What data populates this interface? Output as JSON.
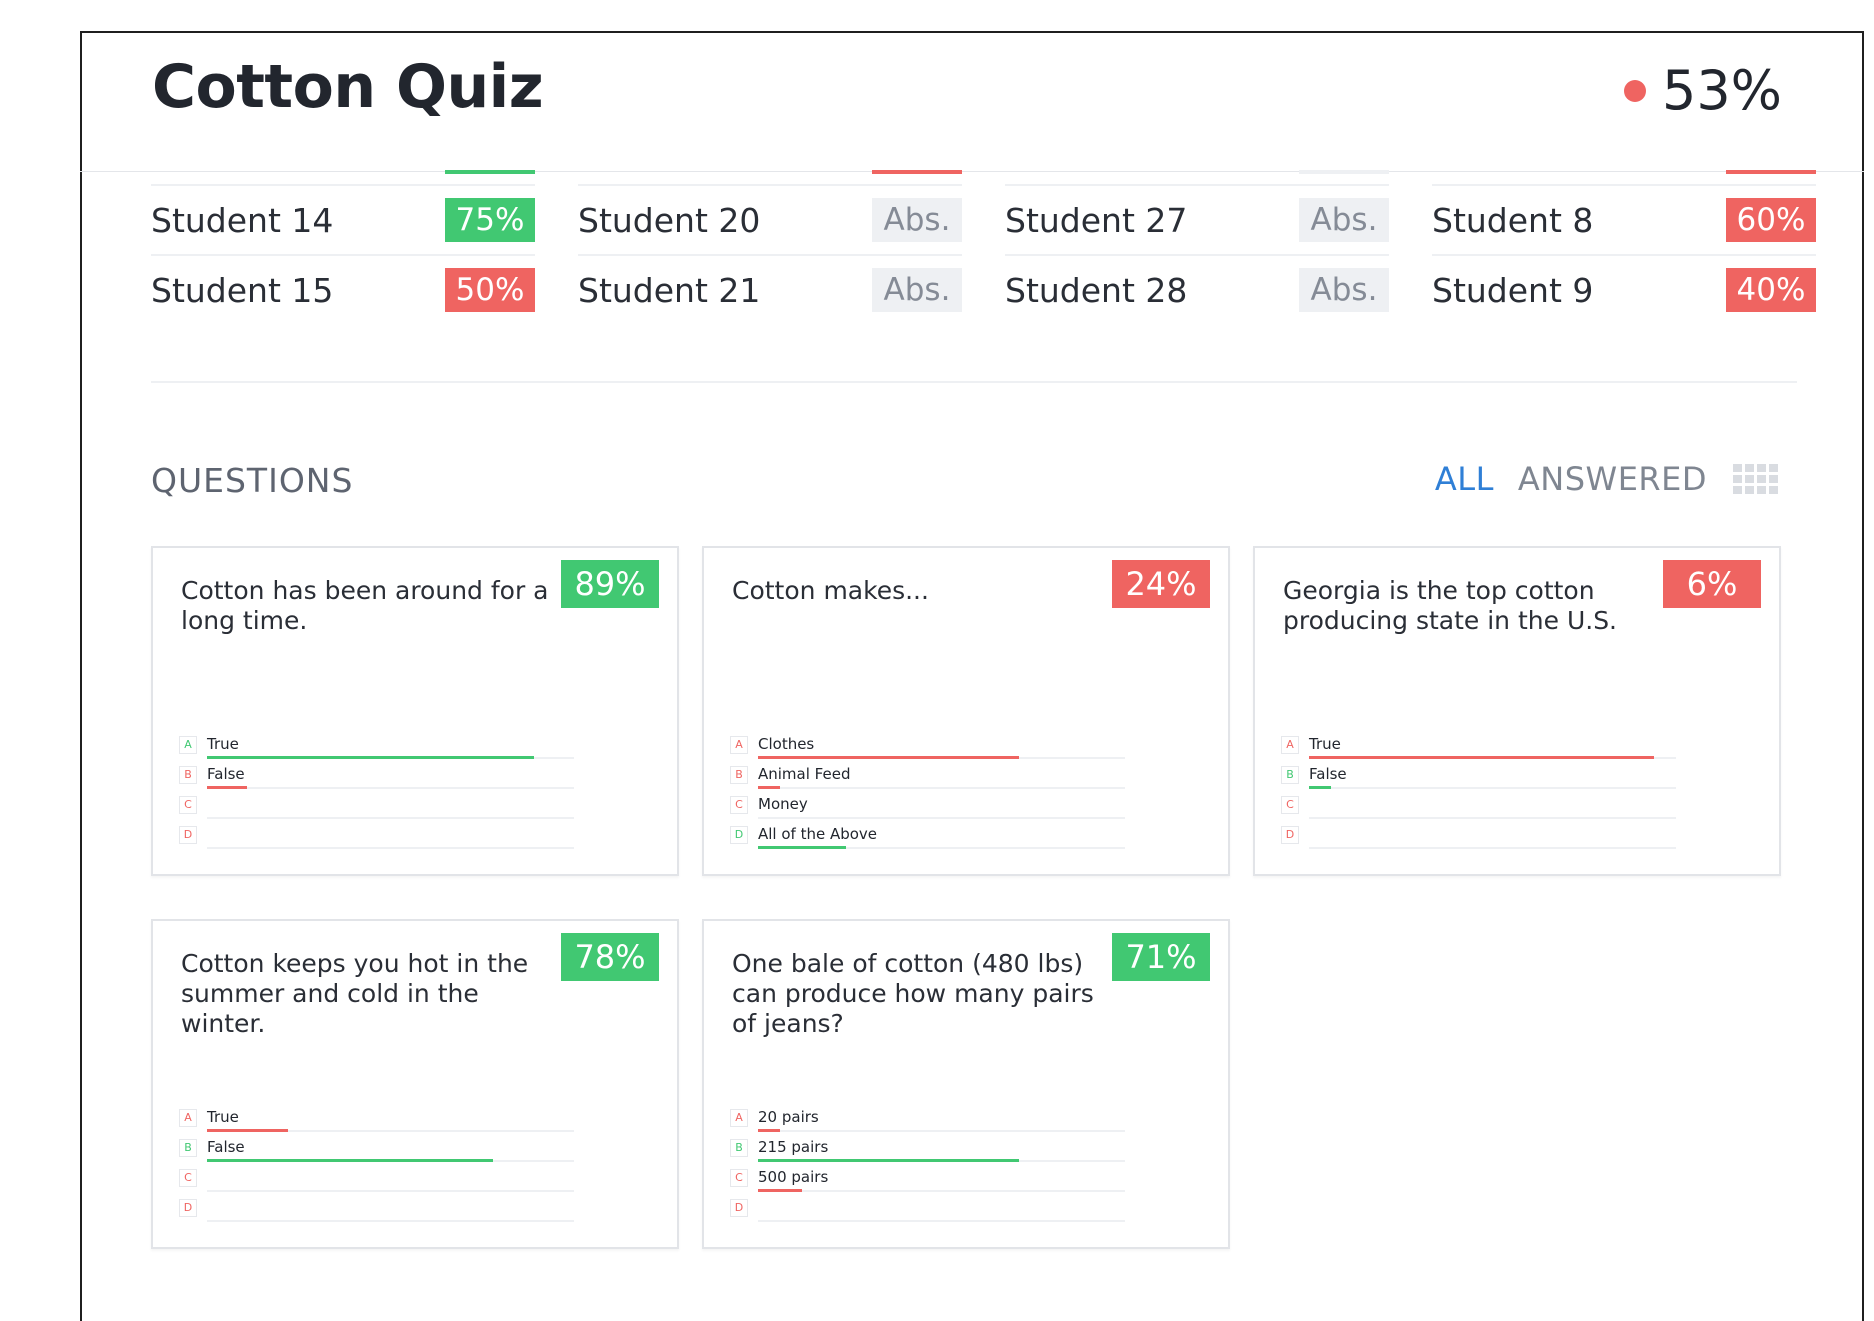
{
  "quiz": {
    "title": "Cotton Quiz",
    "overall_score": "53%",
    "overall_status_color": "#ef6461"
  },
  "colors": {
    "green": "#41c872",
    "red": "#ef6461",
    "blue": "#2f7fd6"
  },
  "students": {
    "columns": [
      {
        "top_sliver": "green",
        "rows": [
          {
            "name": "Student 14",
            "score": "75%",
            "status": "green"
          },
          {
            "name": "Student 15",
            "score": "50%",
            "status": "red"
          }
        ]
      },
      {
        "top_sliver": "red",
        "rows": [
          {
            "name": "Student 20",
            "score": "Abs.",
            "status": "abs"
          },
          {
            "name": "Student 21",
            "score": "Abs.",
            "status": "abs"
          }
        ]
      },
      {
        "top_sliver": "abs",
        "rows": [
          {
            "name": "Student 27",
            "score": "Abs.",
            "status": "abs"
          },
          {
            "name": "Student 28",
            "score": "Abs.",
            "status": "abs"
          }
        ]
      },
      {
        "top_sliver": "red",
        "rows": [
          {
            "name": "Student 8",
            "score": "60%",
            "status": "red"
          },
          {
            "name": "Student 9",
            "score": "40%",
            "status": "red"
          }
        ]
      }
    ]
  },
  "questions": {
    "heading": "QUESTIONS",
    "tabs": [
      {
        "label": "ALL",
        "active": true
      },
      {
        "label": "ANSWERED",
        "active": false
      }
    ],
    "view_icon": "grid-icon",
    "cards": [
      {
        "text": "Cotton has been around for a long time.",
        "score": "89%",
        "status": "green",
        "answers": [
          {
            "letter": "A",
            "label": "True",
            "fill": 0.89,
            "correct": true
          },
          {
            "letter": "B",
            "label": "False",
            "fill": 0.11,
            "correct": false
          },
          {
            "letter": "C",
            "label": "",
            "fill": 0,
            "correct": false
          },
          {
            "letter": "D",
            "label": "",
            "fill": 0,
            "correct": false
          }
        ]
      },
      {
        "text": "Cotton makes...",
        "score": "24%",
        "status": "red",
        "answers": [
          {
            "letter": "A",
            "label": "Clothes",
            "fill": 0.71,
            "correct": false
          },
          {
            "letter": "B",
            "label": "Animal Feed",
            "fill": 0.06,
            "correct": false
          },
          {
            "letter": "C",
            "label": "Money",
            "fill": 0,
            "correct": false
          },
          {
            "letter": "D",
            "label": "All of the Above",
            "fill": 0.24,
            "correct": true
          }
        ]
      },
      {
        "text": "Georgia is the top cotton producing state in the U.S.",
        "score": "6%",
        "status": "red",
        "answers": [
          {
            "letter": "A",
            "label": "True",
            "fill": 0.94,
            "correct": false
          },
          {
            "letter": "B",
            "label": "False",
            "fill": 0.06,
            "correct": true
          },
          {
            "letter": "C",
            "label": "",
            "fill": 0,
            "correct": false
          },
          {
            "letter": "D",
            "label": "",
            "fill": 0,
            "correct": false
          }
        ]
      },
      {
        "text": "Cotton keeps you hot in the summer and cold in the winter.",
        "score": "78%",
        "status": "green",
        "answers": [
          {
            "letter": "A",
            "label": "True",
            "fill": 0.22,
            "correct": false
          },
          {
            "letter": "B",
            "label": "False",
            "fill": 0.78,
            "correct": true
          },
          {
            "letter": "C",
            "label": "",
            "fill": 0,
            "correct": false
          },
          {
            "letter": "D",
            "label": "",
            "fill": 0,
            "correct": false
          }
        ]
      },
      {
        "text": "One bale of cotton (480 lbs) can produce how many pairs of jeans?",
        "score": "71%",
        "status": "green",
        "answers": [
          {
            "letter": "A",
            "label": "20 pairs",
            "fill": 0.06,
            "correct": false
          },
          {
            "letter": "B",
            "label": "215 pairs",
            "fill": 0.71,
            "correct": true
          },
          {
            "letter": "C",
            "label": "500 pairs",
            "fill": 0.12,
            "correct": false
          },
          {
            "letter": "D",
            "label": "",
            "fill": 0,
            "correct": false
          }
        ]
      }
    ]
  }
}
